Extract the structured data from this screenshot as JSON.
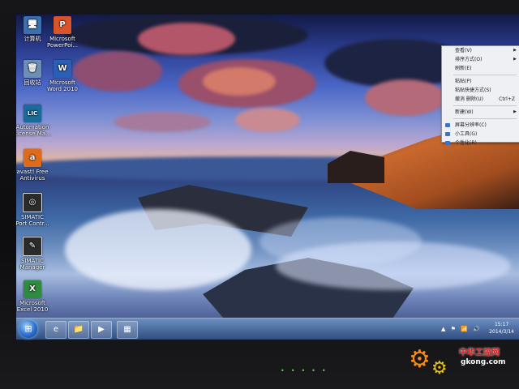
{
  "desktop": {
    "icons": [
      {
        "label": "计算机",
        "glyph": "🖥",
        "color": "#3a6fb0"
      },
      {
        "label": "Microsoft\nPowerPoi...",
        "glyph": "P",
        "color": "#d9532b"
      },
      {
        "label": "回收站",
        "glyph": "🗑",
        "color": "#6d8fb5"
      },
      {
        "label": "Microsoft\nWord 2010",
        "glyph": "W",
        "color": "#2a5fb7"
      },
      {
        "label": "Automation\nLicense Ma...",
        "glyph": "LIC",
        "color": "#1a6a9a"
      },
      {
        "label": "avast! Free\nAntivirus",
        "glyph": "a",
        "color": "#e06a1c"
      },
      {
        "label": "SIMATIC\nPort Contr...",
        "glyph": "◎",
        "color": "#2b2b2b"
      },
      {
        "label": "SIMATIC\nManager",
        "glyph": "✎",
        "color": "#2b2b2b"
      },
      {
        "label": "Microsoft\nExcel 2010",
        "glyph": "X",
        "color": "#2f8b3f"
      }
    ]
  },
  "context_menu": {
    "items": [
      {
        "label": "查看(V)",
        "arrow": "▶"
      },
      {
        "label": "排序方式(O)",
        "arrow": "▶"
      },
      {
        "label": "刷新(E)"
      },
      {
        "sep": true
      },
      {
        "label": "粘贴(P)"
      },
      {
        "label": "粘贴快捷方式(S)"
      },
      {
        "label": "撤消 删除(U)",
        "shortcut": "Ctrl+Z"
      },
      {
        "sep": true
      },
      {
        "label": "新建(W)",
        "arrow": "▶"
      },
      {
        "sep": true
      },
      {
        "label": "屏幕分辨率(C)",
        "icon": true
      },
      {
        "label": "小工具(G)",
        "icon": true
      },
      {
        "label": "个性化(R)",
        "icon": true
      }
    ]
  },
  "taskbar": {
    "start_glyph": "⊞",
    "pinned": [
      {
        "name": "ie",
        "glyph": "e"
      },
      {
        "name": "explorer",
        "glyph": "📁"
      },
      {
        "name": "media-player",
        "glyph": "▶"
      },
      {
        "name": "program",
        "glyph": "▦"
      }
    ],
    "tray_icons": "▲ ⚑ 📶 🔊",
    "clock_time": "15:17",
    "clock_date": "2014/3/14"
  },
  "watermark": {
    "line1": "中华工控网",
    "line2": "gkong.com"
  }
}
